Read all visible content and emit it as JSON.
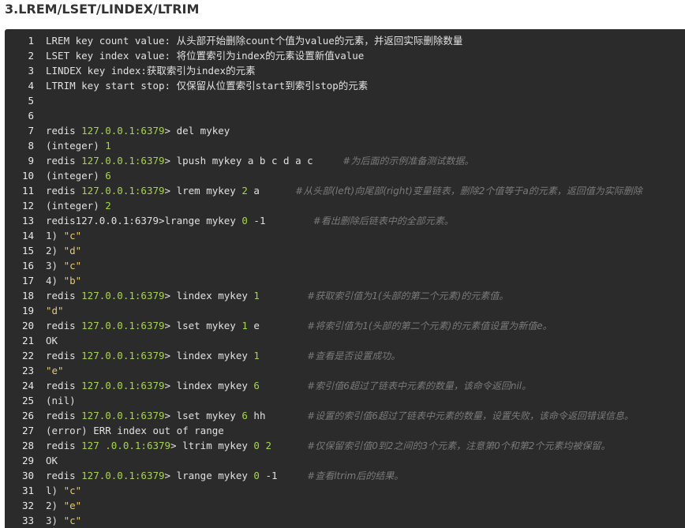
{
  "heading": "3.LREM/LSET/LINDEX/LTRIM",
  "lines": [
    {
      "n": "1",
      "parts": [
        {
          "t": "out",
          "v": "LREM key count value: 从头部开始删除count个值为value的元素，并返回实际删除数量"
        }
      ]
    },
    {
      "n": "2",
      "parts": [
        {
          "t": "out",
          "v": "LSET key index value: 将位置索引为index的元素设置新值value"
        }
      ]
    },
    {
      "n": "3",
      "parts": [
        {
          "t": "out",
          "v": "LINDEX key index:获取索引为index的元素"
        }
      ]
    },
    {
      "n": "4",
      "parts": [
        {
          "t": "out",
          "v": "LTRIM key start stop: 仅保留从位置索引start到索引stop的元素"
        }
      ]
    },
    {
      "n": "5",
      "parts": []
    },
    {
      "n": "6",
      "parts": []
    },
    {
      "n": "7",
      "parts": [
        {
          "t": "out",
          "v": "redis "
        },
        {
          "t": "host",
          "v": "127.0.0.1:6379"
        },
        {
          "t": "arrow",
          "v": "> "
        },
        {
          "t": "cmd",
          "v": "del mykey"
        }
      ]
    },
    {
      "n": "8",
      "parts": [
        {
          "t": "out",
          "v": "(integer) "
        },
        {
          "t": "num",
          "v": "1"
        }
      ]
    },
    {
      "n": "9",
      "parts": [
        {
          "t": "out",
          "v": "redis "
        },
        {
          "t": "host",
          "v": "127.0.0.1:6379"
        },
        {
          "t": "arrow",
          "v": "> "
        },
        {
          "t": "cmd",
          "v": "lpush mykey a b c d a c     "
        },
        {
          "t": "comment",
          "v": "#为后面的示例准备测试数据。"
        }
      ]
    },
    {
      "n": "10",
      "parts": [
        {
          "t": "out",
          "v": "(integer) "
        },
        {
          "t": "num",
          "v": "6"
        }
      ]
    },
    {
      "n": "11",
      "parts": [
        {
          "t": "out",
          "v": "redis "
        },
        {
          "t": "host",
          "v": "127.0.0.1:6379"
        },
        {
          "t": "arrow",
          "v": "> "
        },
        {
          "t": "cmd",
          "v": "lrem mykey "
        },
        {
          "t": "num",
          "v": "2"
        },
        {
          "t": "cmd",
          "v": " a      "
        },
        {
          "t": "comment",
          "v": "#从头部(left)向尾部(right)变量链表，删除2个值等于a的元素，返回值为实际删除"
        }
      ]
    },
    {
      "n": "12",
      "parts": [
        {
          "t": "out",
          "v": "(integer) "
        },
        {
          "t": "num",
          "v": "2"
        }
      ]
    },
    {
      "n": "13",
      "parts": [
        {
          "t": "out",
          "v": "redis127.0.0.1:6379"
        },
        {
          "t": "arrow",
          "v": ">"
        },
        {
          "t": "cmd",
          "v": "lrange mykey "
        },
        {
          "t": "num",
          "v": "0"
        },
        {
          "t": "cmd",
          "v": " -1        "
        },
        {
          "t": "comment",
          "v": "#看出删除后链表中的全部元素。"
        }
      ]
    },
    {
      "n": "14",
      "parts": [
        {
          "t": "out",
          "v": "1) "
        },
        {
          "t": "str",
          "v": "\"c\""
        }
      ]
    },
    {
      "n": "15",
      "parts": [
        {
          "t": "out",
          "v": "2) "
        },
        {
          "t": "str",
          "v": "\"d\""
        }
      ]
    },
    {
      "n": "16",
      "parts": [
        {
          "t": "out",
          "v": "3) "
        },
        {
          "t": "str",
          "v": "\"c\""
        }
      ]
    },
    {
      "n": "17",
      "parts": [
        {
          "t": "out",
          "v": "4) "
        },
        {
          "t": "str",
          "v": "\"b\""
        }
      ]
    },
    {
      "n": "18",
      "parts": [
        {
          "t": "out",
          "v": "redis "
        },
        {
          "t": "host",
          "v": "127.0.0.1:6379"
        },
        {
          "t": "arrow",
          "v": "> "
        },
        {
          "t": "cmd",
          "v": "lindex mykey "
        },
        {
          "t": "num",
          "v": "1"
        },
        {
          "t": "cmd",
          "v": "        "
        },
        {
          "t": "comment",
          "v": "#获取索引值为1(头部的第二个元素)的元素值。"
        }
      ]
    },
    {
      "n": "19",
      "parts": [
        {
          "t": "str",
          "v": "\"d\""
        }
      ]
    },
    {
      "n": "20",
      "parts": [
        {
          "t": "out",
          "v": "redis "
        },
        {
          "t": "host",
          "v": "127.0.0.1:6379"
        },
        {
          "t": "arrow",
          "v": "> "
        },
        {
          "t": "cmd",
          "v": "lset mykey "
        },
        {
          "t": "num",
          "v": "1"
        },
        {
          "t": "cmd",
          "v": " e        "
        },
        {
          "t": "comment",
          "v": "#将索引值为1(头部的第二个元素)的元素值设置为新值e。"
        }
      ]
    },
    {
      "n": "21",
      "parts": [
        {
          "t": "out",
          "v": "OK"
        }
      ]
    },
    {
      "n": "22",
      "parts": [
        {
          "t": "out",
          "v": "redis "
        },
        {
          "t": "host",
          "v": "127.0.0.1:6379"
        },
        {
          "t": "arrow",
          "v": "> "
        },
        {
          "t": "cmd",
          "v": "lindex mykey "
        },
        {
          "t": "num",
          "v": "1"
        },
        {
          "t": "cmd",
          "v": "        "
        },
        {
          "t": "comment",
          "v": "#查看是否设置成功。"
        }
      ]
    },
    {
      "n": "23",
      "parts": [
        {
          "t": "str",
          "v": "\"e\""
        }
      ]
    },
    {
      "n": "24",
      "parts": [
        {
          "t": "out",
          "v": "redis "
        },
        {
          "t": "host",
          "v": "127.0.0.1:6379"
        },
        {
          "t": "arrow",
          "v": "> "
        },
        {
          "t": "cmd",
          "v": "lindex mykey "
        },
        {
          "t": "num",
          "v": "6"
        },
        {
          "t": "cmd",
          "v": "        "
        },
        {
          "t": "comment",
          "v": "#索引值6超过了链表中元素的数量，该命令返回nil。"
        }
      ]
    },
    {
      "n": "25",
      "parts": [
        {
          "t": "out",
          "v": "(nil)"
        }
      ]
    },
    {
      "n": "26",
      "parts": [
        {
          "t": "out",
          "v": "redis "
        },
        {
          "t": "host",
          "v": "127.0.0.1:6379"
        },
        {
          "t": "arrow",
          "v": "> "
        },
        {
          "t": "cmd",
          "v": "lset mykey "
        },
        {
          "t": "num",
          "v": "6"
        },
        {
          "t": "cmd",
          "v": " hh       "
        },
        {
          "t": "comment",
          "v": "#设置的索引值6超过了链表中元素的数量，设置失败，该命令返回错误信息。"
        }
      ]
    },
    {
      "n": "27",
      "parts": [
        {
          "t": "out",
          "v": "(error) ERR index out of range"
        }
      ]
    },
    {
      "n": "28",
      "parts": [
        {
          "t": "out",
          "v": "redis "
        },
        {
          "t": "host",
          "v": "127 .0.0.1:6379"
        },
        {
          "t": "arrow",
          "v": "> "
        },
        {
          "t": "cmd",
          "v": "ltrim mykey "
        },
        {
          "t": "num",
          "v": "0"
        },
        {
          "t": "cmd",
          "v": " "
        },
        {
          "t": "num",
          "v": "2"
        },
        {
          "t": "cmd",
          "v": "      "
        },
        {
          "t": "comment",
          "v": "#仅保留索引值0到2之间的3个元素，注意第0个和第2个元素均被保留。"
        }
      ]
    },
    {
      "n": "29",
      "parts": [
        {
          "t": "out",
          "v": "OK"
        }
      ]
    },
    {
      "n": "30",
      "parts": [
        {
          "t": "out",
          "v": "redis "
        },
        {
          "t": "host",
          "v": "127.0.0.1:6379"
        },
        {
          "t": "arrow",
          "v": "> "
        },
        {
          "t": "cmd",
          "v": "lrange mykey "
        },
        {
          "t": "num",
          "v": "0"
        },
        {
          "t": "cmd",
          "v": " -1     "
        },
        {
          "t": "comment",
          "v": "#查看ltrim后的结果。"
        }
      ]
    },
    {
      "n": "31",
      "parts": [
        {
          "t": "out",
          "v": "l) "
        },
        {
          "t": "str",
          "v": "\"c\""
        }
      ]
    },
    {
      "n": "32",
      "parts": [
        {
          "t": "out",
          "v": "2) "
        },
        {
          "t": "str",
          "v": "\"e\""
        }
      ]
    },
    {
      "n": "33",
      "parts": [
        {
          "t": "out",
          "v": "3) "
        },
        {
          "t": "str",
          "v": "\"c\""
        }
      ]
    }
  ]
}
